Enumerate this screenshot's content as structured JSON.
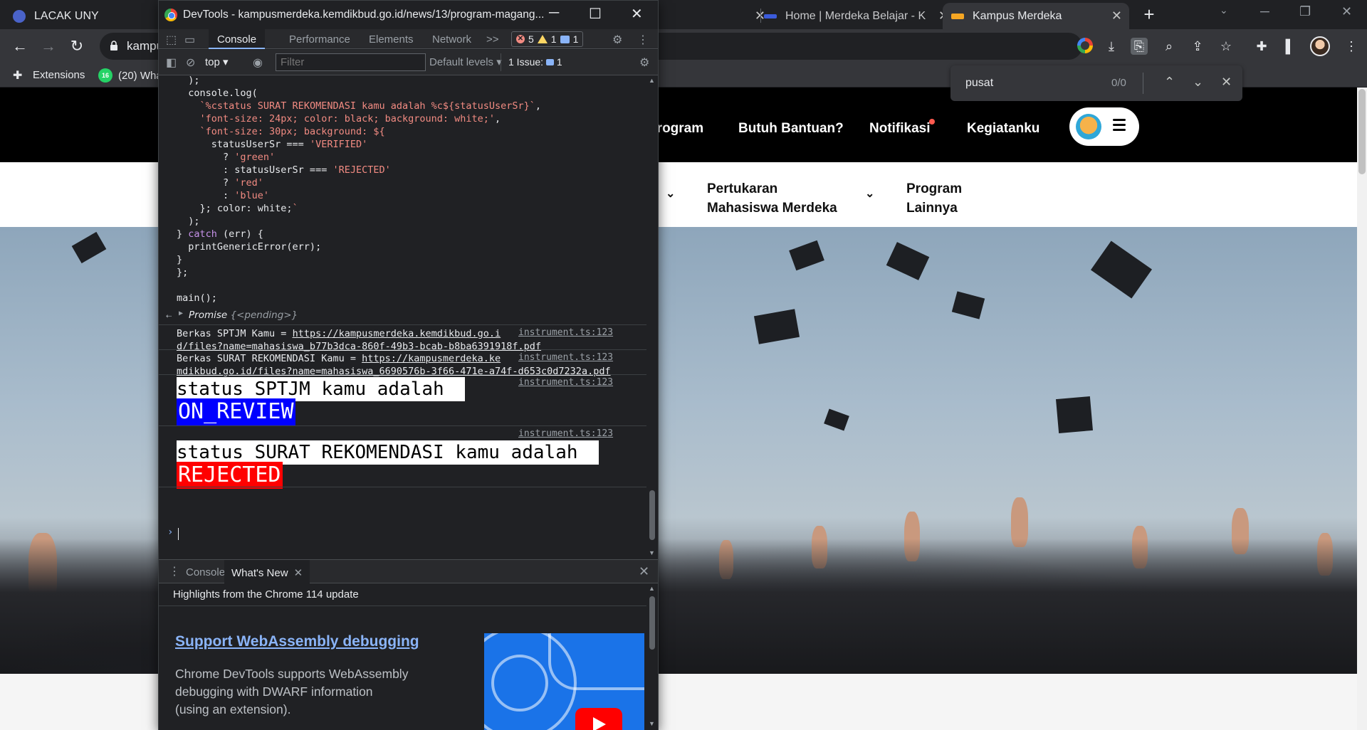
{
  "browser": {
    "tabs": [
      {
        "title": "LACAK UNY",
        "fav_color": "#4a63c9"
      },
      {
        "title": "Home | Merdeka Belajar - K",
        "fav_color": "#3b5bdb"
      },
      {
        "title": "Kampus Merdeka",
        "fav_color": "#f5a623"
      }
    ],
    "url": "kampu",
    "bookmarks": [
      {
        "label": "Extensions",
        "icon": "puzzle-icon"
      },
      {
        "label": "(20) Wha",
        "icon": "whatsapp-icon",
        "badge": "16"
      }
    ],
    "find": {
      "query": "pusat",
      "count": "0/0"
    }
  },
  "site": {
    "nav": [
      "Program",
      "Butuh Bantuan?",
      "Notifikasi",
      "Kegiatanku"
    ],
    "subnav": [
      {
        "line1": "Pertukaran",
        "line2": "Mahasiswa Merdeka"
      },
      {
        "line1": "Program",
        "line2": "Lainnya"
      }
    ]
  },
  "devtools": {
    "title": "DevTools - kampusmerdeka.kemdikbud.go.id/news/13/program-magang...",
    "tabs": [
      "Console",
      "Performance",
      "Elements",
      "Network"
    ],
    "more": ">>",
    "counts": {
      "errors": "5",
      "warnings": "1",
      "info": "1"
    },
    "context": "top",
    "filter_placeholder": "Filter",
    "levels": "Default levels",
    "issues": "1 Issue:",
    "issues_count": "1",
    "code": [
      "  );",
      "  console.log(",
      "    `%cstatus SURAT REKOMENDASI kamu adalah %c${statusUserSr}`,",
      "    'font-size: 24px; color: black; background: white;',",
      "    `font-size: 30px; background: ${",
      "      statusUserSr === 'VERIFIED'",
      "        ? 'green'",
      "        : statusUserSr === 'REJECTED'",
      "        ? 'red'",
      "        : 'blue'",
      "    }; color: white;`",
      "  );",
      "} catch (err) {",
      "  printGenericError(err);",
      "}",
      "};",
      "",
      "main();"
    ],
    "promise": {
      "label": "Promise",
      "state": "{<pending>}"
    },
    "logs": [
      {
        "prefix": "Berkas SPTJM Kamu = ",
        "link1": "https://kampusmerdeka.kemdikbud.go.i",
        "link2": "d/files?name=mahasiswa_b77b3dca-860f-49b3-bcab-b8ba6391918f.pdf",
        "source": "instrument.ts:123"
      },
      {
        "prefix": "Berkas SURAT REKOMENDASI Kamu = ",
        "link1": "https://kampusmerdeka.ke",
        "link2": "mdikbud.go.id/files?name=mahasiswa_6690576b-3f66-471e-a74f-d653c0d7232a.pdf",
        "source": "instrument.ts:123"
      }
    ],
    "status": [
      {
        "label": "status SPTJM kamu adalah ",
        "value": "ON_REVIEW",
        "color": "#0000ff",
        "source": "instrument.ts:123"
      },
      {
        "label": "status SURAT REKOMENDASI kamu adalah ",
        "value": "REJECTED",
        "color": "#ff0000",
        "source": "instrument.ts:123"
      }
    ],
    "drawer": {
      "tabs": [
        "Console",
        "What's New"
      ],
      "highlights": "Highlights from the Chrome 114 update",
      "feature_title": "Support WebAssembly debugging",
      "feature_desc": "Chrome DevTools supports WebAssembly debugging with DWARF information (using an extension)."
    }
  }
}
